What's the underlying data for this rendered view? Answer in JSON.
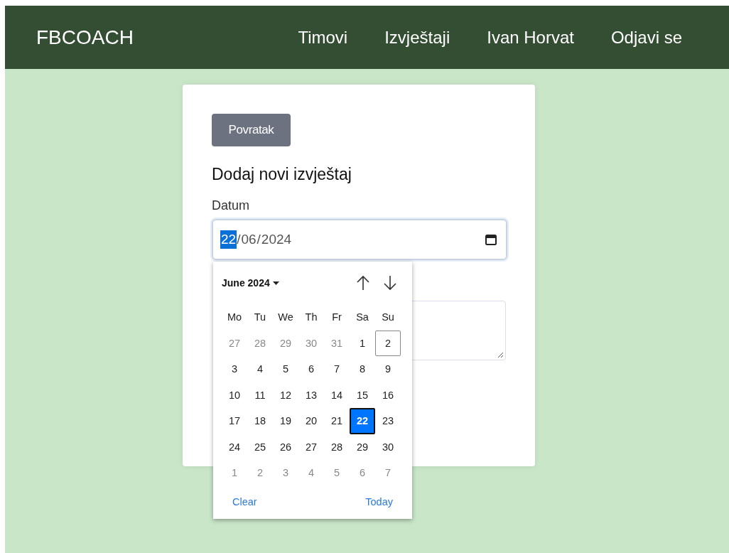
{
  "navbar": {
    "brand": "FBCOACH",
    "links": [
      "Timovi",
      "Izvještaji",
      "Ivan Horvat",
      "Odjavi se"
    ]
  },
  "form": {
    "back_button": "Povratak",
    "heading": "Dodaj novi izvještaj",
    "date_label": "Datum",
    "date_field": {
      "separator": "/",
      "segments": [
        {
          "text": "22",
          "selected": true
        },
        {
          "text": "06",
          "selected": false
        },
        {
          "text": "2024",
          "selected": false
        }
      ]
    }
  },
  "date_picker": {
    "month_label": "June 2024",
    "weekdays": [
      "Mo",
      "Tu",
      "We",
      "Th",
      "Fr",
      "Sa",
      "Su"
    ],
    "days": [
      {
        "label": "27",
        "outside": true,
        "selected": false,
        "today": false
      },
      {
        "label": "28",
        "outside": true,
        "selected": false,
        "today": false
      },
      {
        "label": "29",
        "outside": true,
        "selected": false,
        "today": false
      },
      {
        "label": "30",
        "outside": true,
        "selected": false,
        "today": false
      },
      {
        "label": "31",
        "outside": true,
        "selected": false,
        "today": false
      },
      {
        "label": "1",
        "outside": false,
        "selected": false,
        "today": false
      },
      {
        "label": "2",
        "outside": false,
        "selected": false,
        "today": true
      },
      {
        "label": "3",
        "outside": false,
        "selected": false,
        "today": false
      },
      {
        "label": "4",
        "outside": false,
        "selected": false,
        "today": false
      },
      {
        "label": "5",
        "outside": false,
        "selected": false,
        "today": false
      },
      {
        "label": "6",
        "outside": false,
        "selected": false,
        "today": false
      },
      {
        "label": "7",
        "outside": false,
        "selected": false,
        "today": false
      },
      {
        "label": "8",
        "outside": false,
        "selected": false,
        "today": false
      },
      {
        "label": "9",
        "outside": false,
        "selected": false,
        "today": false
      },
      {
        "label": "10",
        "outside": false,
        "selected": false,
        "today": false
      },
      {
        "label": "11",
        "outside": false,
        "selected": false,
        "today": false
      },
      {
        "label": "12",
        "outside": false,
        "selected": false,
        "today": false
      },
      {
        "label": "13",
        "outside": false,
        "selected": false,
        "today": false
      },
      {
        "label": "14",
        "outside": false,
        "selected": false,
        "today": false
      },
      {
        "label": "15",
        "outside": false,
        "selected": false,
        "today": false
      },
      {
        "label": "16",
        "outside": false,
        "selected": false,
        "today": false
      },
      {
        "label": "17",
        "outside": false,
        "selected": false,
        "today": false
      },
      {
        "label": "18",
        "outside": false,
        "selected": false,
        "today": false
      },
      {
        "label": "19",
        "outside": false,
        "selected": false,
        "today": false
      },
      {
        "label": "20",
        "outside": false,
        "selected": false,
        "today": false
      },
      {
        "label": "21",
        "outside": false,
        "selected": false,
        "today": false
      },
      {
        "label": "22",
        "outside": false,
        "selected": true,
        "today": false
      },
      {
        "label": "23",
        "outside": false,
        "selected": false,
        "today": false
      },
      {
        "label": "24",
        "outside": false,
        "selected": false,
        "today": false
      },
      {
        "label": "25",
        "outside": false,
        "selected": false,
        "today": false
      },
      {
        "label": "26",
        "outside": false,
        "selected": false,
        "today": false
      },
      {
        "label": "27",
        "outside": false,
        "selected": false,
        "today": false
      },
      {
        "label": "28",
        "outside": false,
        "selected": false,
        "today": false
      },
      {
        "label": "29",
        "outside": false,
        "selected": false,
        "today": false
      },
      {
        "label": "30",
        "outside": false,
        "selected": false,
        "today": false
      },
      {
        "label": "1",
        "outside": true,
        "selected": false,
        "today": false
      },
      {
        "label": "2",
        "outside": true,
        "selected": false,
        "today": false
      },
      {
        "label": "3",
        "outside": true,
        "selected": false,
        "today": false
      },
      {
        "label": "4",
        "outside": true,
        "selected": false,
        "today": false
      },
      {
        "label": "5",
        "outside": true,
        "selected": false,
        "today": false
      },
      {
        "label": "6",
        "outside": true,
        "selected": false,
        "today": false
      },
      {
        "label": "7",
        "outside": true,
        "selected": false,
        "today": false
      }
    ],
    "clear_button": "Clear",
    "today_button": "Today"
  }
}
